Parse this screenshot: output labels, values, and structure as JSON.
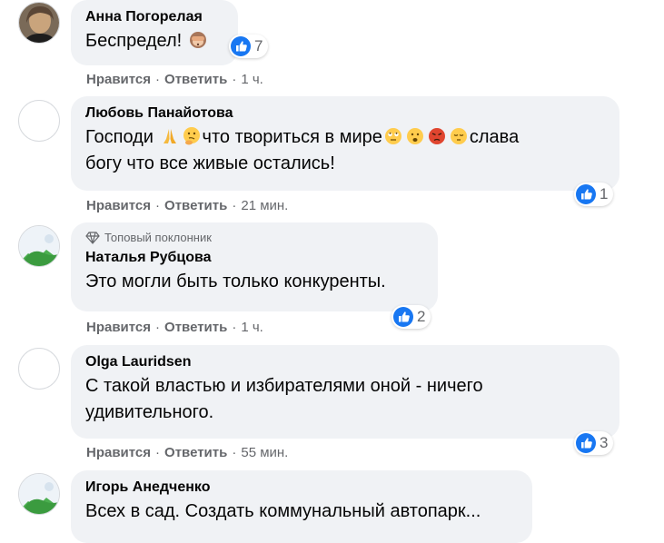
{
  "actions": {
    "like": "Нравится",
    "reply": "Ответить",
    "separator": "·"
  },
  "comments": [
    {
      "author": "Анна Погорелая",
      "text": "Беспредел!",
      "emoji": [
        "see-no-evil-monkey"
      ],
      "reactions": "7",
      "time": "1 ч.",
      "avatar": "photo"
    },
    {
      "author": "Любовь Панайотова",
      "text_parts": [
        "Господи",
        "что творить­ся в мире",
        "слава",
        "богу что все живые остались!"
      ],
      "text_line1_a": "Господи",
      "text_line1_b": "что твориться в мире",
      "text_line1_c": "слава",
      "text_line2": "богу что все живые остались!",
      "emoji_a": [
        "folded-hands",
        "thinking-face"
      ],
      "emoji_b": [
        "rolling-eyes",
        "anguished-face",
        "pouting-face",
        "pensive-face"
      ],
      "reactions": "1",
      "time": "21 мин.",
      "avatar": "blank"
    },
    {
      "badge": "Топовый поклонник",
      "author": "Наталья Рубцова",
      "text": "Это могли быть только конкуренты.",
      "reactions": "2",
      "time": "1 ч.",
      "avatar": "landscape"
    },
    {
      "author": "Olga Lauridsen",
      "text_line1": "С такой властью и избирателями оной - ничего",
      "text_line2": "удивительного.",
      "reactions": "3",
      "time": "55 мин.",
      "avatar": "blank"
    },
    {
      "author": "Игорь Анедченко",
      "text": "Всех в сад. Создать коммунальный автопарк...",
      "avatar": "landscape"
    }
  ],
  "colors": {
    "like_blue": "#1877f2",
    "bubble": "#f0f2f5",
    "meta": "#65676b"
  }
}
